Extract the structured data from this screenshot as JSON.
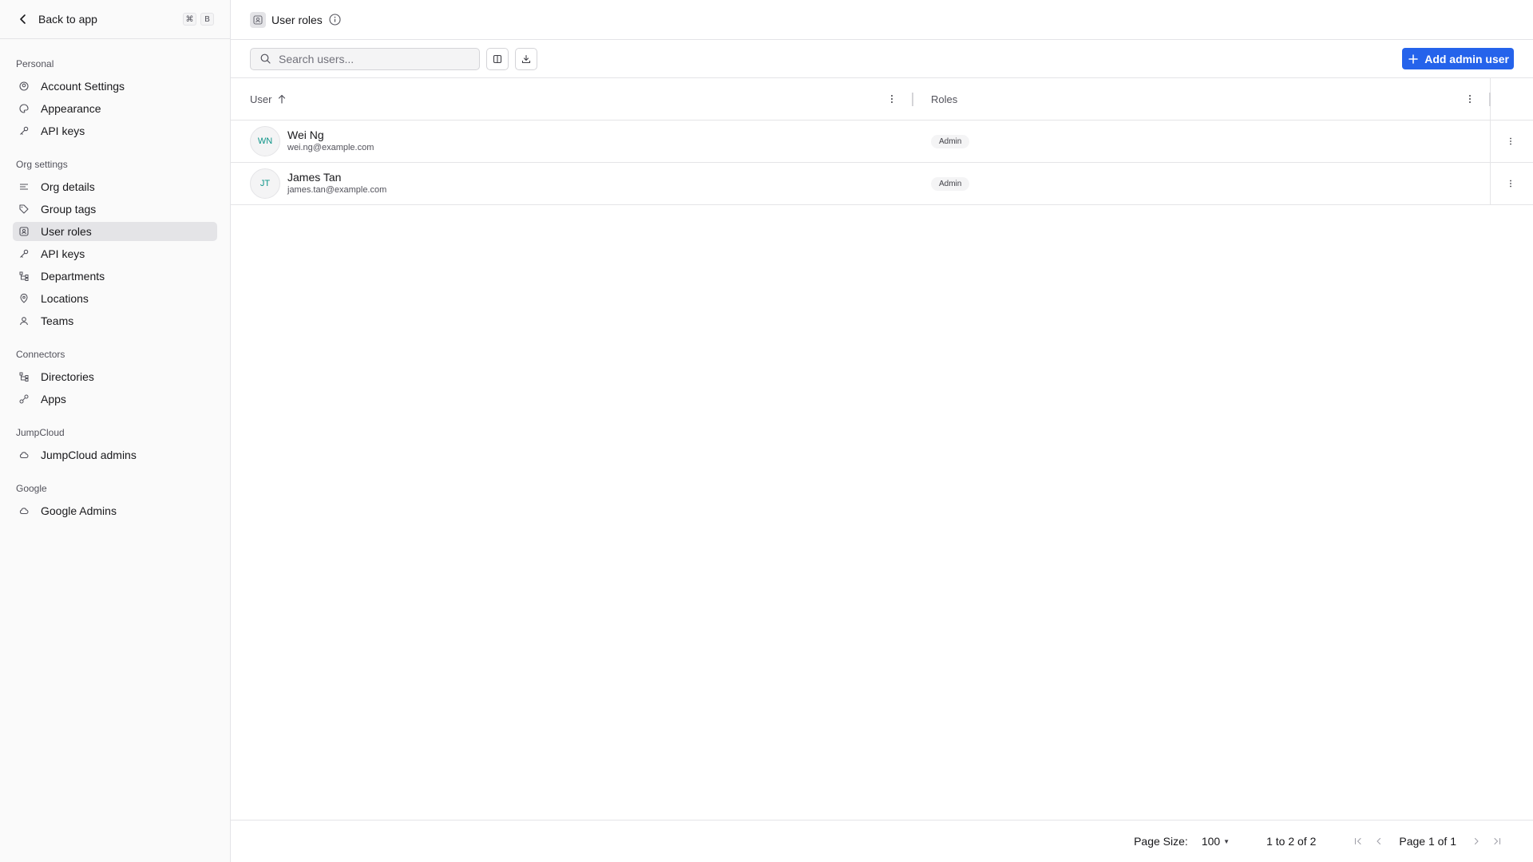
{
  "sidebar": {
    "back_label": "Back to app",
    "shortcut_keys": [
      "⌘",
      "B"
    ],
    "sections": [
      {
        "title": "Personal",
        "items": [
          {
            "label": "Account Settings",
            "icon": "account-settings-icon"
          },
          {
            "label": "Appearance",
            "icon": "palette-icon"
          },
          {
            "label": "API keys",
            "icon": "key-icon"
          }
        ]
      },
      {
        "title": "Org settings",
        "items": [
          {
            "label": "Org details",
            "icon": "lines-icon"
          },
          {
            "label": "Group tags",
            "icon": "tag-icon"
          },
          {
            "label": "User roles",
            "icon": "user-roles-icon",
            "active": true
          },
          {
            "label": "API keys",
            "icon": "key-icon"
          },
          {
            "label": "Departments",
            "icon": "hierarchy-icon"
          },
          {
            "label": "Locations",
            "icon": "map-pin-icon"
          },
          {
            "label": "Teams",
            "icon": "user-icon"
          }
        ]
      },
      {
        "title": "Connectors",
        "items": [
          {
            "label": "Directories",
            "icon": "hierarchy-icon"
          },
          {
            "label": "Apps",
            "icon": "apps-icon"
          }
        ]
      },
      {
        "title": "JumpCloud",
        "items": [
          {
            "label": "JumpCloud admins",
            "icon": "cloud-icon"
          }
        ]
      },
      {
        "title": "Google",
        "items": [
          {
            "label": "Google Admins",
            "icon": "cloud-icon"
          }
        ]
      }
    ]
  },
  "header": {
    "title": "User roles"
  },
  "toolbar": {
    "search_placeholder": "Search users...",
    "add_label": "Add admin user"
  },
  "table": {
    "columns": [
      "User",
      "Roles"
    ],
    "rows": [
      {
        "initials": "WN",
        "name": "Wei Ng",
        "email": "wei.ng@example.com",
        "role": "Admin"
      },
      {
        "initials": "JT",
        "name": "James Tan",
        "email": "james.tan@example.com",
        "role": "Admin"
      }
    ]
  },
  "footer": {
    "page_size_label": "Page Size:",
    "page_size_value": "100",
    "range_text": "1 to 2 of 2",
    "page_text": "Page 1 of 1"
  },
  "colors": {
    "accent": "#2563eb",
    "active_nav": "#e4e4e7",
    "avatar_text": "#0d9488"
  }
}
